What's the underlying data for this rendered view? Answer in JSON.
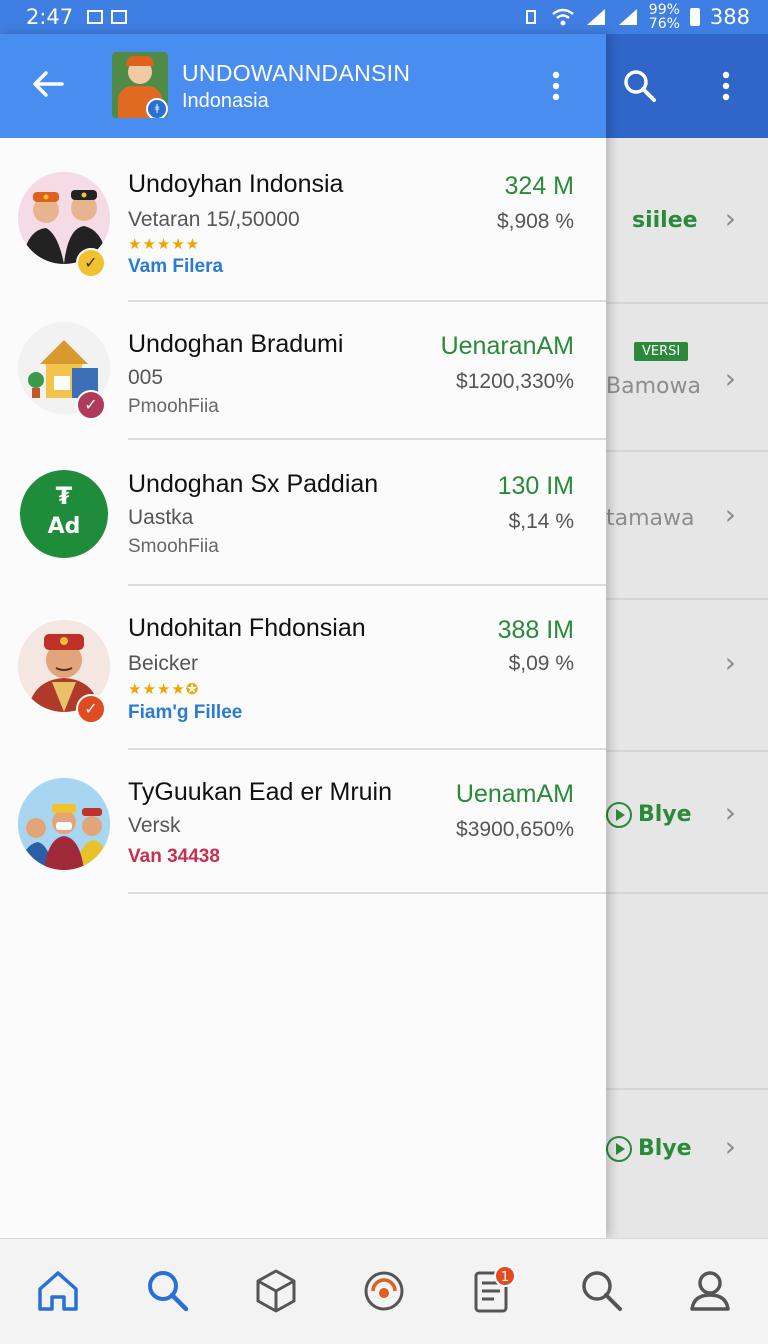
{
  "status_bar": {
    "time": "2:47",
    "battery_pct_top": "99%",
    "battery_pct_bottom": "76%",
    "battery_value": "388"
  },
  "header": {
    "title": "UNDOWANNDANSIN",
    "subtitle": "Indonasia"
  },
  "items": [
    {
      "name": "Undoyhan Indonsia",
      "sub": "Vetaran 15/,50000",
      "stars": "★★★★★",
      "tag": "Vam Filera",
      "tag_style": "blue",
      "value": "324 M",
      "pct": "$,908 %"
    },
    {
      "name": "Undoghan Bradumi",
      "sub": "005",
      "stars": "",
      "tag": "PmoohFiia",
      "tag_style": "gray",
      "value": "UenaranAM",
      "pct": "$1200,330%"
    },
    {
      "name": "Undoghan Sx Paddian",
      "sub": "Uastka",
      "stars": "",
      "tag": "SmoohFiia",
      "tag_style": "gray",
      "value": "130 IM",
      "pct": "$,14 %"
    },
    {
      "name": "Undohitan Fhdonsian",
      "sub": "Beicker",
      "stars": "★★★★✪",
      "tag": "Fiam'g Fillee",
      "tag_style": "blue",
      "value": "388 IM",
      "pct": "$,09 %"
    },
    {
      "name": "TyGuukan Ead er Mruin",
      "sub": "Versk",
      "stars": "",
      "tag": "Van 34438",
      "tag_style": "red",
      "value": "UenamAM",
      "pct": "$3900,650%"
    }
  ],
  "ad_avatar": {
    "label": "Ad",
    "symbol": "₮"
  },
  "background_rows": [
    {
      "text": "siilee",
      "style": "green",
      "badge": ""
    },
    {
      "text": "Bamowa",
      "style": "gray",
      "badge": "VERSI"
    },
    {
      "text": "tamawa",
      "style": "gray",
      "badge": ""
    },
    {
      "text": "",
      "style": "gray",
      "badge": ""
    },
    {
      "text": "Blye",
      "style": "green-play",
      "badge": ""
    },
    {
      "text": "",
      "style": "gray",
      "badge": ""
    },
    {
      "text": "Blye",
      "style": "green-play",
      "badge": ""
    }
  ],
  "bottom_nav": {
    "notification_count": "1"
  },
  "colors": {
    "appbar": "#4a8df0",
    "appbar_dark": "#2f66c8",
    "green": "#2a8a3a",
    "blue_tag": "#2a7bd1",
    "red_tag": "#c9304d"
  }
}
